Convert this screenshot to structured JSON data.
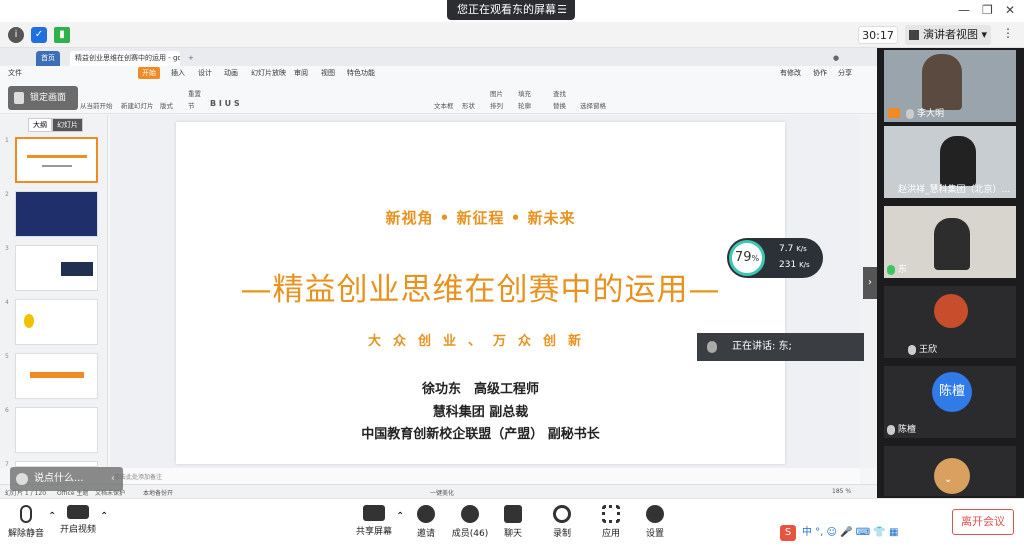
{
  "top_banner": {
    "text": "您正在观看东的屏幕",
    "menu_icon": "list-icon"
  },
  "meeting_bar": {
    "timer": "30:17",
    "view_mode": "演讲者视图"
  },
  "wps": {
    "tabs": [
      "首页",
      "精益创业思维在创赛中的运用 - gdxu"
    ],
    "menus": [
      "文件",
      "开始",
      "插入",
      "设计",
      "动画",
      "幻灯片放映",
      "审阅",
      "视图",
      "特色功能"
    ],
    "ribbon_right": [
      "有修改",
      "协作",
      "分享"
    ],
    "ribbon": [
      "从当前开始",
      "新建幻灯片",
      "版式",
      "节",
      "重置",
      "文本框",
      "形状",
      "图片",
      "排列",
      "填充",
      "轮廓",
      "查找",
      "替换",
      "选择窗格"
    ],
    "lock_screen": "锁定画面",
    "sidebar_tabs": [
      "大纲",
      "幻灯片"
    ],
    "thumb_numbers": [
      "1",
      "2",
      "3",
      "4",
      "5",
      "6",
      "7"
    ],
    "status": {
      "slide": "幻灯片 1 / 120",
      "theme": "Office 主题",
      "protect": "文档未保护",
      "backup": "本地备份开",
      "beautify": "一键美化",
      "zoom": "185 %"
    },
    "notes": "单击此处添加备注"
  },
  "slide": {
    "subtitle": "新视角 • 新征程 • 新未来",
    "title": "—精益创业思维在创赛中的运用—",
    "slogan": "大众创业、万众创新",
    "lines": [
      "徐功东　高级工程师",
      "慧科集团  副总裁",
      "中国教育创新校企联盟（产盟）  副秘书长"
    ]
  },
  "speed_widget": {
    "percent": "79",
    "unit": "%",
    "up": "7.7",
    "down": "231",
    "speed_unit": "K/s"
  },
  "speaking": {
    "label": "正在讲话: 东;"
  },
  "chat_bubble": {
    "text": "说点什么..."
  },
  "participants": [
    {
      "name": "李大明",
      "avatar": ""
    },
    {
      "name": "赵洪祥_慧科集团（北京）...",
      "avatar": ""
    },
    {
      "name": "东",
      "avatar": ""
    },
    {
      "name": "王欣",
      "avatar": ""
    },
    {
      "name": "陈檀",
      "avatar": "陈檀"
    },
    {
      "name": "",
      "avatar": ""
    }
  ],
  "toolbar": {
    "mute": "解除静音",
    "video": "开启视频",
    "share": "共享屏幕",
    "invite": "邀请",
    "members": "成员(46)",
    "chat": "聊天",
    "record": "录制",
    "apps": "应用",
    "settings": "设置",
    "leave": "离开会议",
    "ime": "中 °, ☺ 🎤 ⌨ 👕 ▦"
  },
  "colors": {
    "accent": "#e8921f",
    "wps_orange": "#f08a24",
    "leave_red": "#e05151",
    "dark": "#1c1c1e"
  }
}
